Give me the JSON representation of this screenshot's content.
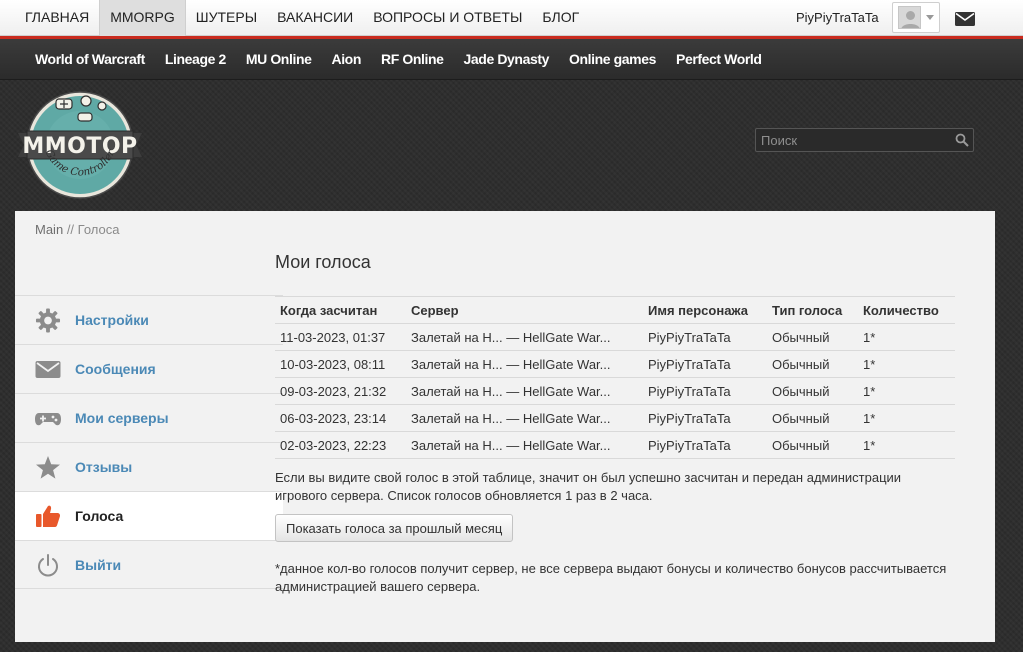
{
  "topnav": {
    "items": [
      {
        "label": "Главная",
        "active": false
      },
      {
        "label": "MMORPG",
        "active": true
      },
      {
        "label": "Шутеры",
        "active": false
      },
      {
        "label": "Вакансии",
        "active": false
      },
      {
        "label": "Вопросы и ответы",
        "active": false
      },
      {
        "label": "Блог",
        "active": false
      }
    ],
    "username": "PiyPiyTraTaTa",
    "avatar_icon": "user-avatar-icon",
    "mail_icon": "envelope-icon"
  },
  "gamenav": {
    "items": [
      "World of Warcraft",
      "Lineage 2",
      "MU Online",
      "Aion",
      "RF Online",
      "Jade Dynasty",
      "Online games",
      "Perfect World"
    ]
  },
  "logo": {
    "text": "MMOTOP",
    "tagline": "Game Controller"
  },
  "search": {
    "placeholder": "Поиск",
    "icon": "magnifier-icon"
  },
  "breadcrumb": {
    "home": "Main",
    "separator": "//",
    "current": "Голоса"
  },
  "sidebar": {
    "items": [
      {
        "label": "Настройки",
        "icon": "gear-icon",
        "active": false
      },
      {
        "label": "Сообщения",
        "icon": "envelope-icon",
        "active": false
      },
      {
        "label": "Мои серверы",
        "icon": "gamepad-icon",
        "active": false
      },
      {
        "label": "Отзывы",
        "icon": "star-icon",
        "active": false
      },
      {
        "label": "Голоса",
        "icon": "thumbs-up-icon",
        "active": true
      },
      {
        "label": "Выйти",
        "icon": "power-icon",
        "active": false
      }
    ]
  },
  "main": {
    "title": "Мои голоса",
    "table": {
      "headers": [
        "Когда засчитан",
        "Сервер",
        "Имя персонажа",
        "Тип голоса",
        "Количество"
      ],
      "rows": [
        [
          "11-03-2023, 01:37",
          "Залетай на Н... — HellGate War...",
          "PiyPiyTraTaTa",
          "Обычный",
          "1*"
        ],
        [
          "10-03-2023, 08:11",
          "Залетай на Н... — HellGate War...",
          "PiyPiyTraTaTa",
          "Обычный",
          "1*"
        ],
        [
          "09-03-2023, 21:32",
          "Залетай на Н... — HellGate War...",
          "PiyPiyTraTaTa",
          "Обычный",
          "1*"
        ],
        [
          "06-03-2023, 23:14",
          "Залетай на Н... — HellGate War...",
          "PiyPiyTraTaTa",
          "Обычный",
          "1*"
        ],
        [
          "02-03-2023, 22:23",
          "Залетай на Н... — HellGate War...",
          "PiyPiyTraTaTa",
          "Обычный",
          "1*"
        ]
      ]
    },
    "info": "Если вы видите свой голос в этой таблице, значит он был успешно засчитан и передан администрации игрового сервера. Список голосов обновляется 1 раз в 2 часа.",
    "button_prev_month": "Показать голоса за прошлый месяц",
    "footnote": "*данное кол-во голосов получит сервер, не все сервера выдают бонусы и количество бонусов рассчитывается администрацией вашего сервера."
  },
  "colors": {
    "accent_red": "#c92b1f",
    "link_blue": "#4b89b6",
    "logo_teal": "#5fa9a5",
    "thumb_orange": "#e8582b"
  }
}
